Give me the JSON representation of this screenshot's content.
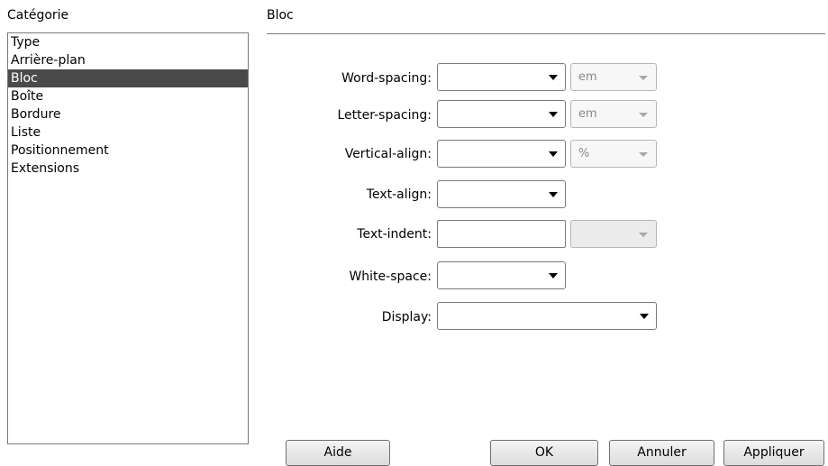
{
  "category_panel": {
    "label": "Catégorie",
    "items": [
      "Type",
      "Arrière-plan",
      "Bloc",
      "Boîte",
      "Bordure",
      "Liste",
      "Positionnement",
      "Extensions"
    ],
    "selected": "Bloc"
  },
  "section": {
    "title": "Bloc"
  },
  "fields": {
    "word_spacing": {
      "label": "Word-spacing:",
      "value": "",
      "unit": "em"
    },
    "letter_spacing": {
      "label": "Letter-spacing:",
      "value": "",
      "unit": "em"
    },
    "vertical_align": {
      "label": "Vertical-align:",
      "value": "",
      "unit": "%"
    },
    "text_align": {
      "label": "Text-align:",
      "value": ""
    },
    "text_indent": {
      "label": "Text-indent:",
      "value": "",
      "unit": ""
    },
    "white_space": {
      "label": "White-space:",
      "value": ""
    },
    "display": {
      "label": "Display:",
      "value": ""
    }
  },
  "buttons": {
    "help": "Aide",
    "ok": "OK",
    "cancel": "Annuler",
    "apply": "Appliquer"
  }
}
